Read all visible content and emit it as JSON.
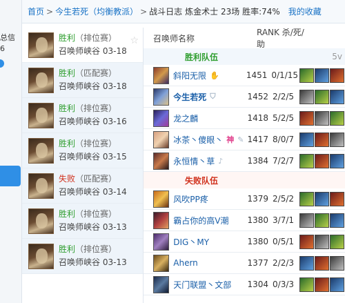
{
  "left_strip": {
    "frag1": "总信",
    "frag2": "6"
  },
  "breadcrumb": {
    "home": "首页",
    "sep1": ">",
    "summoner": "今生若死（均衡教派）",
    "sep2": ">",
    "page": "战斗日志",
    "summary": "炼金术士 23场 胜率:74%",
    "favorites": "我的收藏"
  },
  "matches": [
    {
      "result": "胜利",
      "result_type": "win",
      "mode": "（排位赛）",
      "map": "召唤师峡谷",
      "date": "03-18",
      "selected": true
    },
    {
      "result": "胜利",
      "result_type": "win",
      "mode": "（匹配赛）",
      "map": "召唤师峡谷",
      "date": "03-18",
      "selected": false
    },
    {
      "result": "胜利",
      "result_type": "win",
      "mode": "（排位赛）",
      "map": "召唤师峡谷",
      "date": "03-16",
      "selected": false
    },
    {
      "result": "胜利",
      "result_type": "win",
      "mode": "（排位赛）",
      "map": "召唤师峡谷",
      "date": "03-15",
      "selected": false
    },
    {
      "result": "失败",
      "result_type": "loss",
      "mode": "（匹配赛）",
      "map": "召唤师峡谷",
      "date": "03-14",
      "selected": false
    },
    {
      "result": "胜利",
      "result_type": "win",
      "mode": "（排位赛）",
      "map": "召唤师峡谷",
      "date": "03-13",
      "selected": false
    },
    {
      "result": "胜利",
      "result_type": "win",
      "mode": "（排位赛）",
      "map": "召唤师峡谷",
      "date": "03-13",
      "selected": false
    }
  ],
  "table": {
    "col_name": "召唤师名称",
    "col_rank": "RANK 杀/死/助",
    "win_team_label": "胜利队伍",
    "win_team_right": "5v",
    "loss_team_label": "失败队伍",
    "win_players": [
      {
        "name": "斜阳无限",
        "rank": "1451",
        "kda": "0/1/15",
        "icon": "hand-icon",
        "me": false
      },
      {
        "name": "今生若死",
        "rank": "1452",
        "kda": "2/2/5",
        "icon": "shield-icon",
        "me": true
      },
      {
        "name": "龙之麟",
        "rank": "1418",
        "kda": "5/2/5",
        "icon": "",
        "me": false
      },
      {
        "name": "冰茶丶傻眼丶",
        "rank": "1417",
        "kda": "8/0/7",
        "icon": "feather-icon",
        "badge": "神",
        "me": false
      },
      {
        "name": "永恒情丶草",
        "rank": "1384",
        "kda": "7/2/7",
        "icon": "bell-icon",
        "me": false
      }
    ],
    "loss_players": [
      {
        "name": "风吹PP疼",
        "rank": "1379",
        "kda": "2/5/2"
      },
      {
        "name": "霸占你的高V潮",
        "rank": "1380",
        "kda": "3/7/1"
      },
      {
        "name": "DIG丶MY",
        "rank": "1380",
        "kda": "0/5/1"
      },
      {
        "name": "Ahern",
        "rank": "1377",
        "kda": "2/2/3"
      },
      {
        "name": "天门联盟丶文部",
        "rank": "1304",
        "kda": "0/3/3"
      }
    ]
  }
}
